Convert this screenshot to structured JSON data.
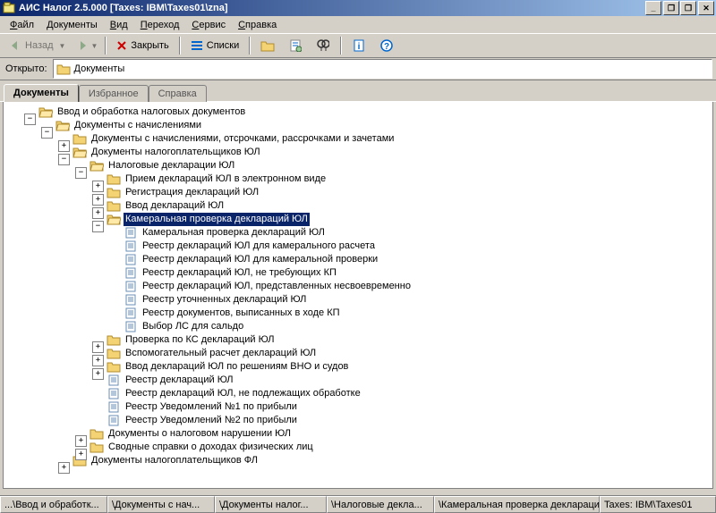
{
  "window": {
    "title": "АИС Налог 2.5.000 [Taxes: IBM\\Taxes01\\zna]",
    "buttons": {
      "min": "_",
      "max": "🗗",
      "restore": "🗗",
      "close": "✕"
    }
  },
  "menu": [
    "Файл",
    "Документы",
    "Вид",
    "Переход",
    "Сервис",
    "Справка"
  ],
  "toolbar": {
    "back_label": "Назад",
    "close_label": "Закрыть",
    "lists_label": "Списки"
  },
  "address": {
    "label": "Открыто:",
    "value": "Документы"
  },
  "tabs": [
    "Документы",
    "Избранное",
    "Справка"
  ],
  "tree": [
    {
      "d": 0,
      "exp": "-",
      "ic": "ofolder",
      "t": "Ввод и обработка налоговых документов"
    },
    {
      "d": 1,
      "exp": "-",
      "ic": "ofolder",
      "t": "Документы с начислениями"
    },
    {
      "d": 2,
      "exp": "+",
      "ic": "folder",
      "t": "Документы с начислениями, отсрочками, рассрочками и зачетами"
    },
    {
      "d": 2,
      "exp": "-",
      "ic": "ofolder",
      "t": "Документы налогоплательщиков ЮЛ"
    },
    {
      "d": 3,
      "exp": "-",
      "ic": "ofolder",
      "t": "Налоговые декларации ЮЛ"
    },
    {
      "d": 4,
      "exp": "+",
      "ic": "folder",
      "t": "Прием деклараций ЮЛ в электронном виде"
    },
    {
      "d": 4,
      "exp": "+",
      "ic": "folder",
      "t": "Регистрация деклараций ЮЛ"
    },
    {
      "d": 4,
      "exp": "+",
      "ic": "folder",
      "t": "Ввод деклараций ЮЛ"
    },
    {
      "d": 4,
      "exp": "-",
      "ic": "ofolder",
      "t": "Камеральная проверка деклараций ЮЛ",
      "sel": true,
      "name": "kameralnaya-proverka"
    },
    {
      "d": 5,
      "exp": "",
      "ic": "doc",
      "t": "Камеральная проверка деклараций ЮЛ"
    },
    {
      "d": 5,
      "exp": "",
      "ic": "doc",
      "t": "Реестр деклараций ЮЛ для камерального расчета"
    },
    {
      "d": 5,
      "exp": "",
      "ic": "doc",
      "t": "Реестр деклараций ЮЛ для камеральной проверки"
    },
    {
      "d": 5,
      "exp": "",
      "ic": "doc",
      "t": "Реестр деклараций ЮЛ, не требующих КП"
    },
    {
      "d": 5,
      "exp": "",
      "ic": "doc",
      "t": "Реестр деклараций ЮЛ, представленных несвоевременно"
    },
    {
      "d": 5,
      "exp": "",
      "ic": "doc",
      "t": "Реестр уточненных деклараций ЮЛ"
    },
    {
      "d": 5,
      "exp": "",
      "ic": "doc",
      "t": "Реестр документов, выписанных в ходе КП"
    },
    {
      "d": 5,
      "exp": "",
      "ic": "doc",
      "t": "Выбор ЛС для сальдо"
    },
    {
      "d": 4,
      "exp": "+",
      "ic": "folder",
      "t": "Проверка по КС деклараций ЮЛ"
    },
    {
      "d": 4,
      "exp": "+",
      "ic": "folder",
      "t": "Вспомогательный расчет деклараций ЮЛ"
    },
    {
      "d": 4,
      "exp": "+",
      "ic": "folder",
      "t": "Ввод деклараций ЮЛ по решениям ВНО и судов"
    },
    {
      "d": 4,
      "exp": "",
      "ic": "doc",
      "t": "Реестр деклараций ЮЛ"
    },
    {
      "d": 4,
      "exp": "",
      "ic": "doc",
      "t": "Реестр деклараций ЮЛ, не подлежащих обработке"
    },
    {
      "d": 4,
      "exp": "",
      "ic": "doc",
      "t": "Реестр Уведомлений №1 по прибыли"
    },
    {
      "d": 4,
      "exp": "",
      "ic": "doc",
      "t": "Реестр Уведомлений №2 по прибыли"
    },
    {
      "d": 3,
      "exp": "+",
      "ic": "folder",
      "t": "Документы о налоговом нарушении ЮЛ"
    },
    {
      "d": 3,
      "exp": "+",
      "ic": "folder",
      "t": "Сводные справки о доходах физических лиц"
    },
    {
      "d": 2,
      "exp": "+",
      "ic": "folder",
      "t": "Документы налогоплательщиков ФЛ"
    }
  ],
  "status": {
    "c1": "...\\Ввод и обработк...",
    "c2": "\\Документы с нач...",
    "c3": "\\Документы налог...",
    "c4": "\\Налоговые декла...",
    "c5": "\\Камеральная проверка деклараций...",
    "c6": "Taxes: IBM\\Taxes01"
  }
}
